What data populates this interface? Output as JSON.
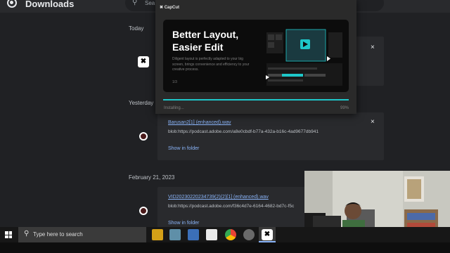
{
  "downloads": {
    "title": "Downloads",
    "search_placeholder": "Sea",
    "sections": {
      "today": "Today",
      "yesterday": "Yesterday",
      "feb21": "February 21, 2023"
    },
    "items": [
      {
        "file_name": "Barusan2[1] (enhanced).wav",
        "url": "blob:https://podcast.adobe.com/a8e0cbdf-b77a-432a-b16c-4ad9677db941",
        "show_in_folder": "Show in folder",
        "close": "×"
      },
      {
        "file_name": "VID20230220234739(2)(2)[1] (enhanced).wav",
        "url": "blob:https://podcast.adobe.com/f36c4d7e-6164-4682-bd7c-f5c",
        "show_in_folder": "Show in folder"
      }
    ],
    "today_close": "×"
  },
  "installer": {
    "brand": "CapCut",
    "headline": "Better Layout, Easier Edit",
    "description": "Diligent layout is perfectly adapted to your big screen, brings convenience and efficiency to your creative process.",
    "page_indicator": "1/3",
    "status": "Installing...",
    "percent": "99%",
    "progress": 0.99,
    "accent_color": "#1ec7c9"
  },
  "taskbar": {
    "search_text": "Type here to search"
  }
}
